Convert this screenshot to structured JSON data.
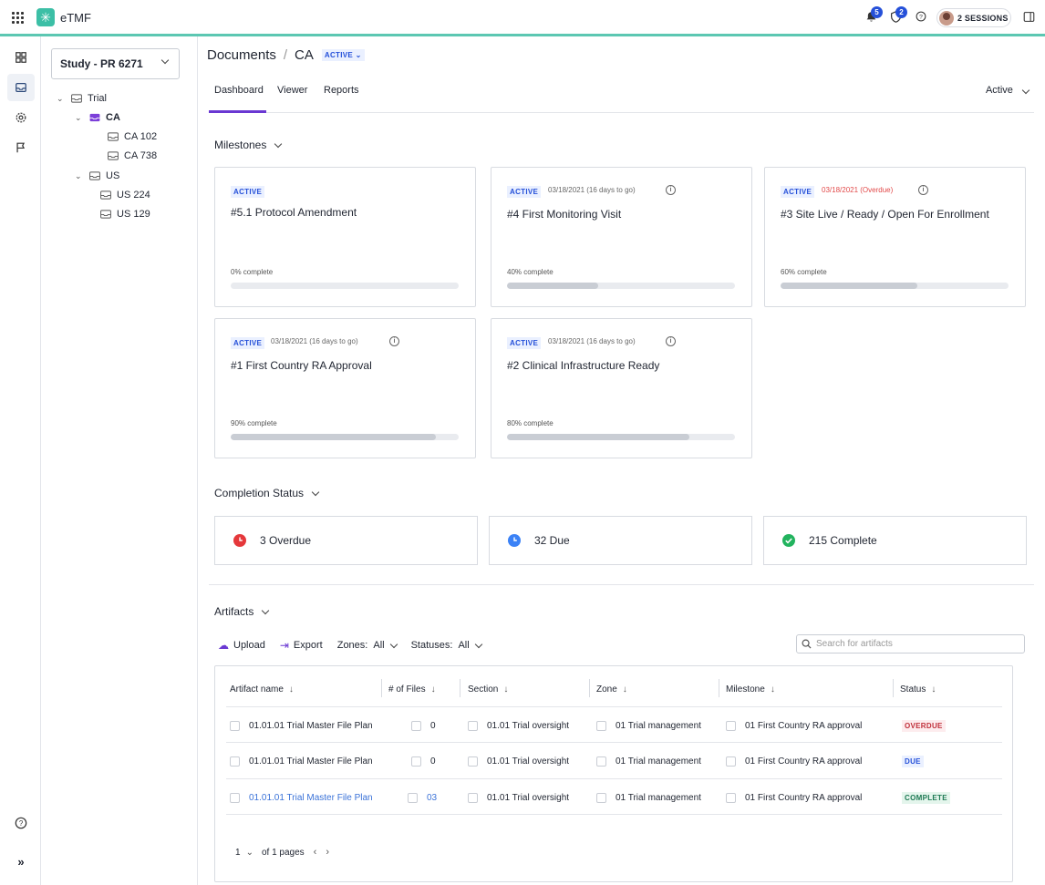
{
  "app": {
    "name": "eTMF"
  },
  "header": {
    "notifications_count": "5",
    "alerts_count": "2",
    "sessions_label": "2 SESSIONS"
  },
  "tree": {
    "study_label": "Study - PR 6271",
    "nodes": {
      "trial": "Trial",
      "ca": "CA",
      "ca102": "CA 102",
      "ca738": "CA 738",
      "us": "US",
      "us224": "US 224",
      "us129": "US 129"
    }
  },
  "breadcrumb": {
    "root": "Documents",
    "sep": "/",
    "current": "CA",
    "status": "ACTIVE"
  },
  "tabs": [
    "Dashboard",
    "Viewer",
    "Reports"
  ],
  "filter_right": "Active",
  "milestones": {
    "title": "Milestones",
    "cards": [
      {
        "tag": "ACTIVE",
        "date": "",
        "title": "#5.1 Protocol Amendment",
        "pct_label": "0% complete",
        "progress": 0
      },
      {
        "tag": "ACTIVE",
        "date": "03/18/2021 (16 days to go)",
        "title": "#4 First Monitoring Visit",
        "pct_label": "40% complete",
        "progress": 40
      },
      {
        "tag": "ACTIVE",
        "date": "03/18/2021 (Overdue)",
        "title": "#3 Site Live / Ready / Open For Enrollment",
        "pct_label": "60% complete",
        "progress": 60
      },
      {
        "tag": "ACTIVE",
        "date": "03/18/2021 (16 days to go)",
        "title": "#1 First Country RA Approval",
        "pct_label": "90% complete",
        "progress": 90
      },
      {
        "tag": "ACTIVE",
        "date": "03/18/2021 (16 days to go)",
        "title": "#2 Clinical Infrastructure Ready",
        "pct_label": "80% complete",
        "progress": 80
      }
    ]
  },
  "completion": {
    "title": "Completion Status",
    "items": [
      {
        "label": "3 Overdue",
        "color": "#e5383b"
      },
      {
        "label": "32 Due",
        "color": "#3b82f6"
      },
      {
        "label": "215 Complete",
        "color": "#22b35e"
      }
    ]
  },
  "artifacts": {
    "title": "Artifacts",
    "toolbar": {
      "upload": "Upload",
      "export": "Export",
      "zones_label": "Zones:",
      "zones_value": "All",
      "statuses_label": "Statuses:",
      "statuses_value": "All"
    },
    "search_placeholder": "Search for artifacts",
    "columns": [
      "Artifact name",
      "# of Files",
      "Section",
      "Zone",
      "Milestone",
      "Status"
    ],
    "rows": [
      {
        "name": "01.01.01 Trial Master File Plan",
        "files": "0",
        "section": "01.01 Trial oversight",
        "zone": "01 Trial management",
        "milestone": "01 First Country RA approval",
        "status": "OVERDUE"
      },
      {
        "name": "01.01.01 Trial Master File Plan",
        "files": "0",
        "section": "01.01 Trial oversight",
        "zone": "01 Trial management",
        "milestone": "01 First Country RA approval",
        "status": "DUE"
      },
      {
        "name": "01.01.01 Trial Master File Plan",
        "files": "03",
        "section": "01.01 Trial oversight",
        "zone": "01 Trial management",
        "milestone": "01 First Country RA approval",
        "status": "COMPLETE"
      }
    ],
    "pager": {
      "page": "1",
      "of_pages": "of 1 pages"
    }
  },
  "colors": {
    "accent": "#6a38d2",
    "brand": "#3cbfa6",
    "progress_fill": "#c9cdd4"
  }
}
